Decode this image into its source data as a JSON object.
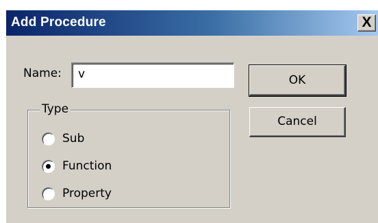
{
  "window": {
    "title": "Add Procedure",
    "close_glyph": "X"
  },
  "form": {
    "name_label": "Name:",
    "name_value": "v"
  },
  "buttons": {
    "ok_label": "OK",
    "cancel_label": "Cancel"
  },
  "type_group": {
    "legend": "Type",
    "options": [
      {
        "label": "Sub",
        "selected": false
      },
      {
        "label": "Function",
        "selected": true
      },
      {
        "label": "Property",
        "selected": false
      }
    ]
  },
  "colors": {
    "title_bar_start": "#0a246a",
    "title_bar_end": "#a6caf0",
    "dialog_face": "#d4d0c8"
  }
}
